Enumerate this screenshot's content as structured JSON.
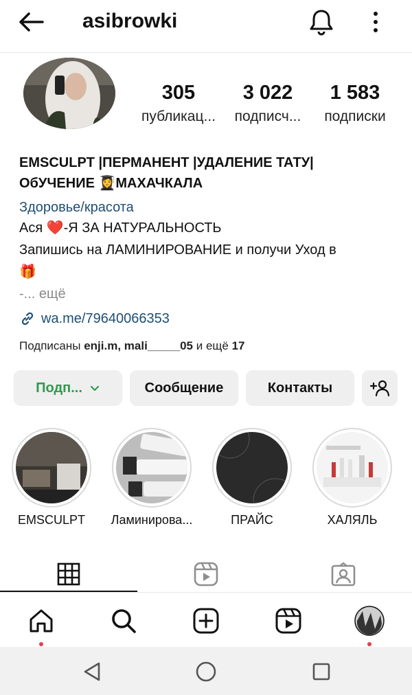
{
  "header": {
    "username": "asibrowki",
    "icons": {
      "back": "arrow-left-icon",
      "notifications": "bell-icon",
      "more": "more-vertical-icon"
    }
  },
  "stats": [
    {
      "value": "305",
      "label": "публикац..."
    },
    {
      "value": "3 022",
      "label": "подписч..."
    },
    {
      "value": "1 583",
      "label": "подписки"
    }
  ],
  "bio": {
    "name_line1": "EMSCULPT |ПЕРМАНЕНТ |УДАЛЕНИЕ ТАТУ|",
    "name_line2": "ОбУЧЕНИЕ 👩‍🎓МАХАЧКАЛА",
    "category": "Здоровье/красота",
    "line1": "Ася ❤️-Я ЗА НАТУРАЛЬНОСТЬ",
    "line2": "Запишись на ЛАМИНИРОВАНИЕ и получи Уход в",
    "line3": "🎁",
    "more": "-... ещё",
    "link": "wa.me/79640066353"
  },
  "followed_by": {
    "prefix": "Подписаны",
    "users": "enji.m, mali_____05",
    "suffix": "и ещё",
    "count": "17"
  },
  "actions": {
    "subscribe": "Подп...",
    "message": "Сообщение",
    "contacts": "Контакты"
  },
  "highlights": [
    {
      "label": "EMSCULPT"
    },
    {
      "label": "Ламинирова..."
    },
    {
      "label": "ПРАЙС"
    },
    {
      "label": "ХАЛЯЛЬ"
    }
  ],
  "tabs": [
    "grid-icon",
    "reels-icon",
    "tagged-icon"
  ],
  "bottom_nav": [
    "home-icon",
    "search-icon",
    "create-icon",
    "reels-icon",
    "profile-avatar"
  ],
  "colors": {
    "link": "#1d4e74",
    "subscribe_text": "#2e9b4d",
    "notification_dot": "#ed3a4f",
    "button_bg": "#efefef"
  }
}
